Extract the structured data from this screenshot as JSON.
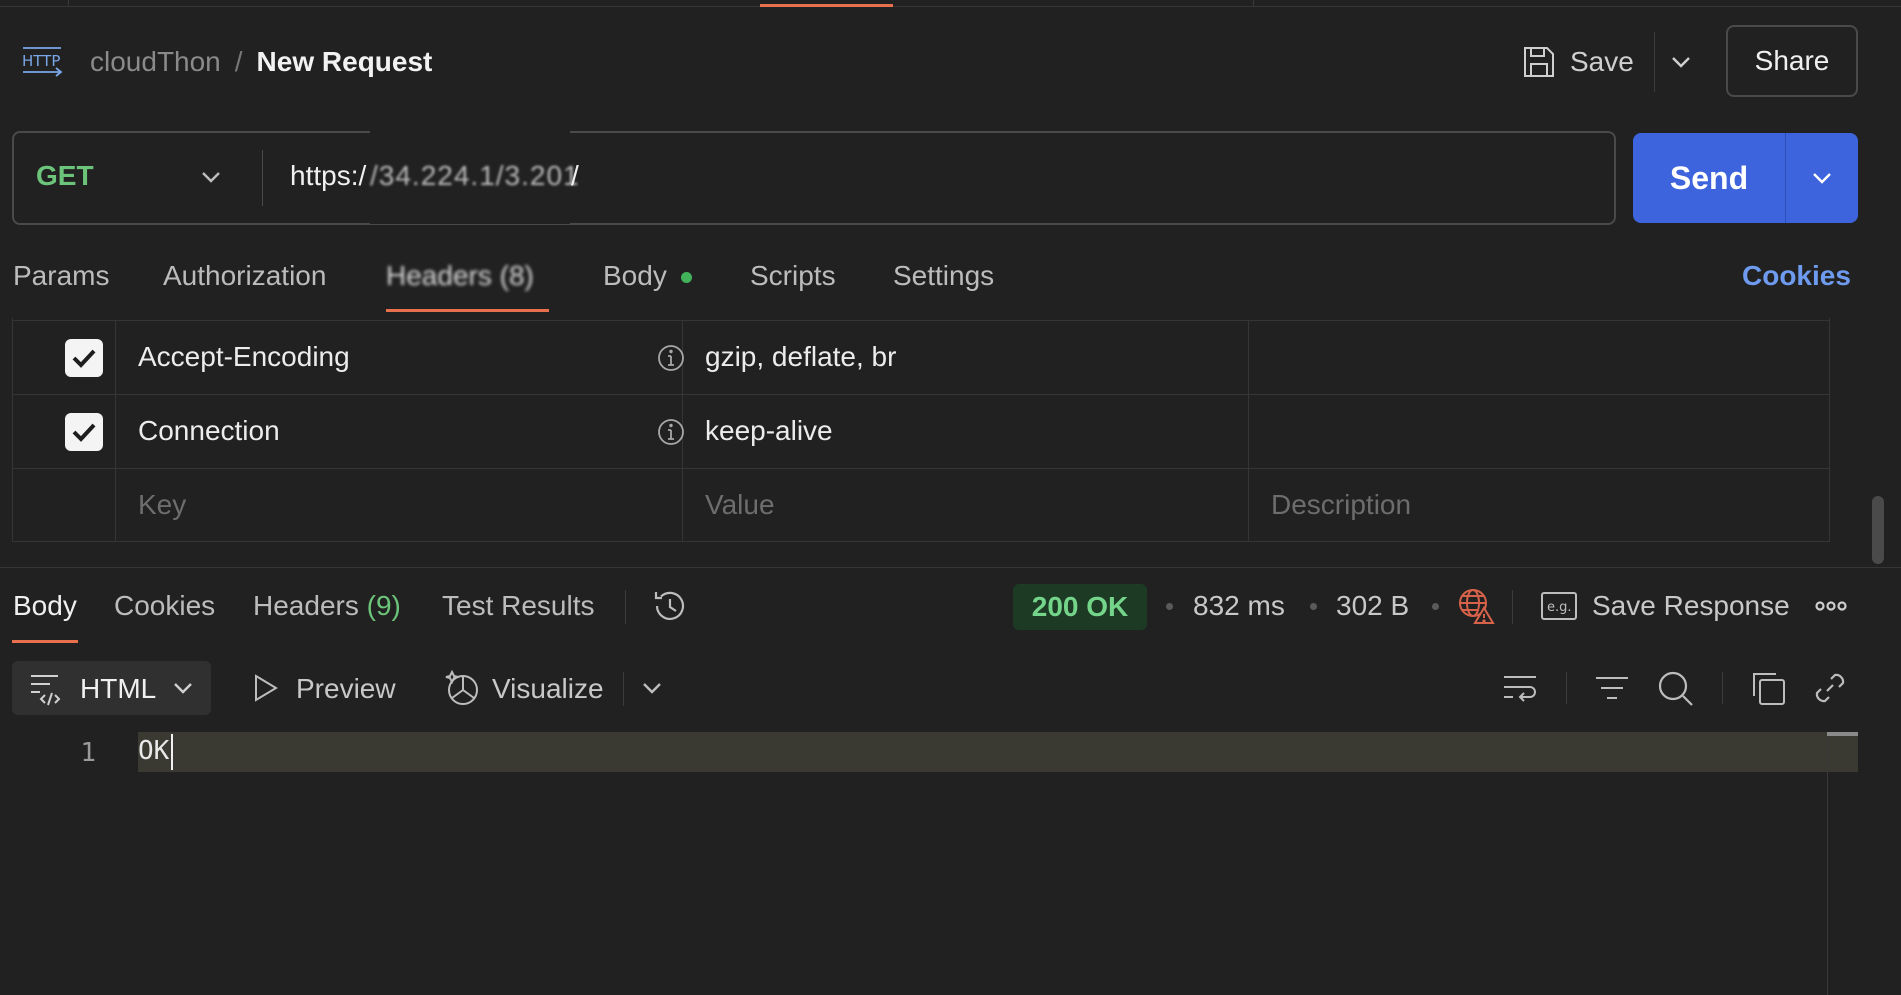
{
  "header": {
    "workspace": "cloudThon",
    "separator": "/",
    "request_name": "New Request",
    "save_label": "Save",
    "share_label": "Share",
    "icon": "http-icon"
  },
  "request": {
    "method": "GET",
    "url_prefix": "https:/",
    "url_masked": "/34.224.1/3.201",
    "url_suffix": "/",
    "send_label": "Send"
  },
  "request_tabs": {
    "params": "Params",
    "authorization": "Authorization",
    "headers": "Headers (8)",
    "body": "Body",
    "scripts": "Scripts",
    "settings": "Settings",
    "cookies": "Cookies"
  },
  "headers_table": {
    "rows": [
      {
        "key": "Accept-Encoding",
        "value": "gzip, deflate, br",
        "checked": true
      },
      {
        "key": "Connection",
        "value": "keep-alive",
        "checked": true
      }
    ],
    "placeholder": {
      "key": "Key",
      "value": "Value",
      "description": "Description"
    }
  },
  "response_tabs": {
    "body": "Body",
    "cookies": "Cookies",
    "headers": "Headers",
    "headers_count": "(9)",
    "test_results": "Test Results"
  },
  "response_meta": {
    "status": "200 OK",
    "time": "832 ms",
    "size": "302 B",
    "save_response": "Save Response"
  },
  "toolbar": {
    "format": "HTML",
    "preview": "Preview",
    "visualize": "Visualize"
  },
  "editor": {
    "lines": [
      {
        "number": "1",
        "text": "OK"
      }
    ]
  },
  "colors": {
    "accent": "#e8704d",
    "send": "#3d63dd",
    "method": "#6cc47a",
    "status": "#74d58a",
    "link": "#6e9bef"
  }
}
